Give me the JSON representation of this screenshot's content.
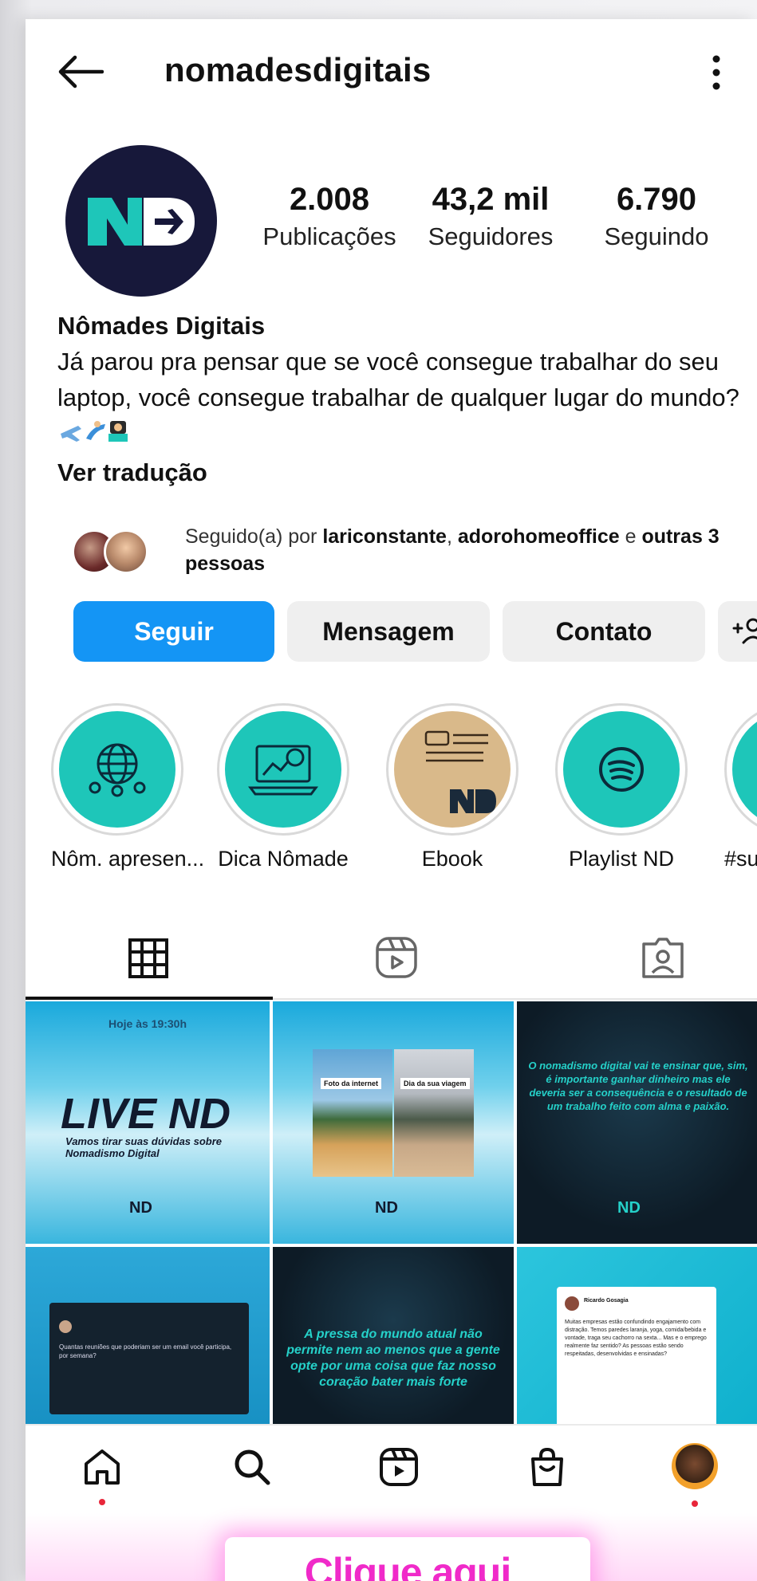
{
  "header": {
    "username": "nomadesdigitais"
  },
  "profile": {
    "avatar_text": "ND",
    "stats": [
      {
        "value": "2.008",
        "label": "Publicações"
      },
      {
        "value": "43,2 mil",
        "label": "Seguidores"
      },
      {
        "value": "6.790",
        "label": "Seguindo"
      }
    ],
    "name": "Nômades Digitais",
    "bio": "Já parou pra pensar que se você consegue trabalhar do seu laptop, você consegue trabalhar de qualquer lugar do mundo?",
    "bio_emojis": "✈️🏄👩‍💻",
    "see_translation": "Ver tradução",
    "followed_by": {
      "prefix": "Seguido(a) por ",
      "user1": "lariconstante",
      "sep": ", ",
      "user2": "adorohomeoffice",
      "and": " e ",
      "others": "outras 3 pessoas"
    }
  },
  "actions": {
    "follow": "Seguir",
    "message": "Mensagem",
    "contact": "Contato"
  },
  "highlights": [
    {
      "label": "Nôm. apresen...",
      "icon": "globe-network-icon"
    },
    {
      "label": "Dica Nômade",
      "icon": "laptop-chart-icon"
    },
    {
      "label": "Ebook",
      "icon": "ebook-cover"
    },
    {
      "label": "Playlist ND",
      "icon": "spotify-icon"
    },
    {
      "label": "#sup",
      "icon": "highlight-partial"
    }
  ],
  "posts": {
    "p1": {
      "time": "Hoje às 19:30h",
      "title": "LIVE ND",
      "subtitle": "Vamos tirar suas dúvidas sobre Nomadismo Digital",
      "logo": "ND"
    },
    "p2": {
      "left": "Foto da internet",
      "right": "Dia da sua viagem",
      "logo": "ND"
    },
    "p3": {
      "quote": "O nomadismo digital vai te ensinar que, sim, é importante ganhar dinheiro mas ele deveria ser a consequência e o resultado de um trabalho feito com alma e paixão.",
      "logo": "ND"
    },
    "p4": {
      "line1": "Quantas reuniões que poderiam ser um email você",
      "line2": "participa, por semana?"
    },
    "p5": {
      "quote": "A pressa do mundo atual não permite nem ao menos que a gente opte por uma coisa que faz nosso coração bater mais forte"
    },
    "p6": {
      "author": "Ricardo Gosagia",
      "text": "Muitas empresas estão confundindo engajamento com distração. Temos paredes laranja, yoga, comida/bebida e vontade, traga seu cachorro na sexta... Mas e o emprego realmente faz sentido? As pessoas estão sendo respeitadas, desenvolvidas e ensinadas?"
    }
  },
  "cta": {
    "label": "Clique aqui"
  },
  "colors": {
    "accent": "#1495f5",
    "teal": "#1ec6b9",
    "cta": "#f02ac9"
  }
}
